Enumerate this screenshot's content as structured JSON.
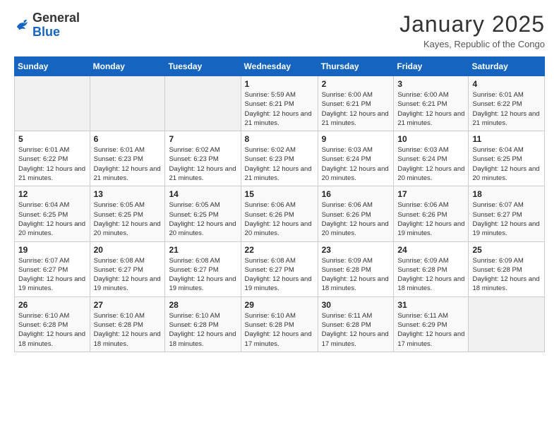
{
  "logo": {
    "general": "General",
    "blue": "Blue"
  },
  "header": {
    "month_year": "January 2025",
    "location": "Kayes, Republic of the Congo"
  },
  "weekdays": [
    "Sunday",
    "Monday",
    "Tuesday",
    "Wednesday",
    "Thursday",
    "Friday",
    "Saturday"
  ],
  "weeks": [
    [
      {
        "day": "",
        "sunrise": "",
        "sunset": "",
        "daylight": "",
        "empty": true
      },
      {
        "day": "",
        "sunrise": "",
        "sunset": "",
        "daylight": "",
        "empty": true
      },
      {
        "day": "",
        "sunrise": "",
        "sunset": "",
        "daylight": "",
        "empty": true
      },
      {
        "day": "1",
        "sunrise": "Sunrise: 5:59 AM",
        "sunset": "Sunset: 6:21 PM",
        "daylight": "Daylight: 12 hours and 21 minutes."
      },
      {
        "day": "2",
        "sunrise": "Sunrise: 6:00 AM",
        "sunset": "Sunset: 6:21 PM",
        "daylight": "Daylight: 12 hours and 21 minutes."
      },
      {
        "day": "3",
        "sunrise": "Sunrise: 6:00 AM",
        "sunset": "Sunset: 6:21 PM",
        "daylight": "Daylight: 12 hours and 21 minutes."
      },
      {
        "day": "4",
        "sunrise": "Sunrise: 6:01 AM",
        "sunset": "Sunset: 6:22 PM",
        "daylight": "Daylight: 12 hours and 21 minutes."
      }
    ],
    [
      {
        "day": "5",
        "sunrise": "Sunrise: 6:01 AM",
        "sunset": "Sunset: 6:22 PM",
        "daylight": "Daylight: 12 hours and 21 minutes."
      },
      {
        "day": "6",
        "sunrise": "Sunrise: 6:01 AM",
        "sunset": "Sunset: 6:23 PM",
        "daylight": "Daylight: 12 hours and 21 minutes."
      },
      {
        "day": "7",
        "sunrise": "Sunrise: 6:02 AM",
        "sunset": "Sunset: 6:23 PM",
        "daylight": "Daylight: 12 hours and 21 minutes."
      },
      {
        "day": "8",
        "sunrise": "Sunrise: 6:02 AM",
        "sunset": "Sunset: 6:23 PM",
        "daylight": "Daylight: 12 hours and 21 minutes."
      },
      {
        "day": "9",
        "sunrise": "Sunrise: 6:03 AM",
        "sunset": "Sunset: 6:24 PM",
        "daylight": "Daylight: 12 hours and 20 minutes."
      },
      {
        "day": "10",
        "sunrise": "Sunrise: 6:03 AM",
        "sunset": "Sunset: 6:24 PM",
        "daylight": "Daylight: 12 hours and 20 minutes."
      },
      {
        "day": "11",
        "sunrise": "Sunrise: 6:04 AM",
        "sunset": "Sunset: 6:25 PM",
        "daylight": "Daylight: 12 hours and 20 minutes."
      }
    ],
    [
      {
        "day": "12",
        "sunrise": "Sunrise: 6:04 AM",
        "sunset": "Sunset: 6:25 PM",
        "daylight": "Daylight: 12 hours and 20 minutes."
      },
      {
        "day": "13",
        "sunrise": "Sunrise: 6:05 AM",
        "sunset": "Sunset: 6:25 PM",
        "daylight": "Daylight: 12 hours and 20 minutes."
      },
      {
        "day": "14",
        "sunrise": "Sunrise: 6:05 AM",
        "sunset": "Sunset: 6:25 PM",
        "daylight": "Daylight: 12 hours and 20 minutes."
      },
      {
        "day": "15",
        "sunrise": "Sunrise: 6:06 AM",
        "sunset": "Sunset: 6:26 PM",
        "daylight": "Daylight: 12 hours and 20 minutes."
      },
      {
        "day": "16",
        "sunrise": "Sunrise: 6:06 AM",
        "sunset": "Sunset: 6:26 PM",
        "daylight": "Daylight: 12 hours and 20 minutes."
      },
      {
        "day": "17",
        "sunrise": "Sunrise: 6:06 AM",
        "sunset": "Sunset: 6:26 PM",
        "daylight": "Daylight: 12 hours and 19 minutes."
      },
      {
        "day": "18",
        "sunrise": "Sunrise: 6:07 AM",
        "sunset": "Sunset: 6:27 PM",
        "daylight": "Daylight: 12 hours and 19 minutes."
      }
    ],
    [
      {
        "day": "19",
        "sunrise": "Sunrise: 6:07 AM",
        "sunset": "Sunset: 6:27 PM",
        "daylight": "Daylight: 12 hours and 19 minutes."
      },
      {
        "day": "20",
        "sunrise": "Sunrise: 6:08 AM",
        "sunset": "Sunset: 6:27 PM",
        "daylight": "Daylight: 12 hours and 19 minutes."
      },
      {
        "day": "21",
        "sunrise": "Sunrise: 6:08 AM",
        "sunset": "Sunset: 6:27 PM",
        "daylight": "Daylight: 12 hours and 19 minutes."
      },
      {
        "day": "22",
        "sunrise": "Sunrise: 6:08 AM",
        "sunset": "Sunset: 6:27 PM",
        "daylight": "Daylight: 12 hours and 19 minutes."
      },
      {
        "day": "23",
        "sunrise": "Sunrise: 6:09 AM",
        "sunset": "Sunset: 6:28 PM",
        "daylight": "Daylight: 12 hours and 18 minutes."
      },
      {
        "day": "24",
        "sunrise": "Sunrise: 6:09 AM",
        "sunset": "Sunset: 6:28 PM",
        "daylight": "Daylight: 12 hours and 18 minutes."
      },
      {
        "day": "25",
        "sunrise": "Sunrise: 6:09 AM",
        "sunset": "Sunset: 6:28 PM",
        "daylight": "Daylight: 12 hours and 18 minutes."
      }
    ],
    [
      {
        "day": "26",
        "sunrise": "Sunrise: 6:10 AM",
        "sunset": "Sunset: 6:28 PM",
        "daylight": "Daylight: 12 hours and 18 minutes."
      },
      {
        "day": "27",
        "sunrise": "Sunrise: 6:10 AM",
        "sunset": "Sunset: 6:28 PM",
        "daylight": "Daylight: 12 hours and 18 minutes."
      },
      {
        "day": "28",
        "sunrise": "Sunrise: 6:10 AM",
        "sunset": "Sunset: 6:28 PM",
        "daylight": "Daylight: 12 hours and 18 minutes."
      },
      {
        "day": "29",
        "sunrise": "Sunrise: 6:10 AM",
        "sunset": "Sunset: 6:28 PM",
        "daylight": "Daylight: 12 hours and 17 minutes."
      },
      {
        "day": "30",
        "sunrise": "Sunrise: 6:11 AM",
        "sunset": "Sunset: 6:28 PM",
        "daylight": "Daylight: 12 hours and 17 minutes."
      },
      {
        "day": "31",
        "sunrise": "Sunrise: 6:11 AM",
        "sunset": "Sunset: 6:29 PM",
        "daylight": "Daylight: 12 hours and 17 minutes."
      },
      {
        "day": "",
        "sunrise": "",
        "sunset": "",
        "daylight": "",
        "empty": true
      }
    ]
  ]
}
